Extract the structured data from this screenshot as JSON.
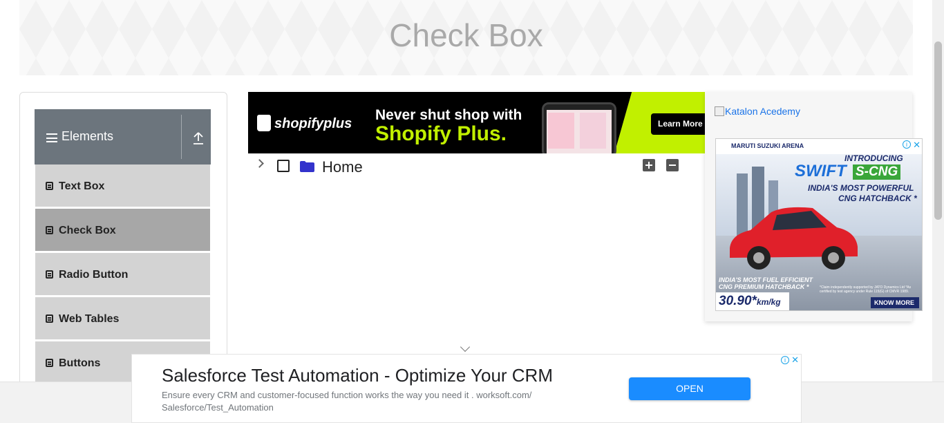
{
  "banner": {
    "title": "Check Box"
  },
  "sidebar": {
    "group_label": "Elements",
    "items": [
      {
        "label": "Text Box"
      },
      {
        "label": "Check Box",
        "active": true
      },
      {
        "label": "Radio Button"
      },
      {
        "label": "Web Tables"
      },
      {
        "label": "Buttons"
      }
    ]
  },
  "top_ad": {
    "brand": "shopifyplus",
    "headline_line1": "Never shut shop with",
    "headline_line2": "Shopify Plus.",
    "cta": "Learn More"
  },
  "tree": {
    "root_label": "Home",
    "checked": false,
    "expanded": false,
    "folder_color": "#3333cc",
    "expand_icon": "plus-icon",
    "collapse_icon": "minus-icon"
  },
  "right_ads": {
    "katalon_alt": "Katalon Acedemy",
    "car_ad": {
      "brand": "MARUTI SUZUKI ARENA",
      "introducing": "INTRODUCING",
      "model": "SWIFT",
      "variant": "S-CNG",
      "tagline1": "INDIA'S MOST POWERFUL",
      "tagline2": "CNG HATCHBACK *",
      "fuel1": "INDIA'S MOST FUEL EFFICIENT",
      "fuel2": "CNG PREMIUM HATCHBACK *",
      "mileage_value": "30.90*",
      "mileage_unit": "km/kg",
      "claim": "*Claim independently supported by JATO Dynamics Ltd *As certified by test agency under Rule 115(G) of CMVR 1989.",
      "cta": "KNOW MORE"
    }
  },
  "bottom_ad": {
    "title": "Salesforce Test Automation - Optimize Your CRM",
    "desc_line1": "Ensure every CRM and customer-focused function works the way you need it . worksoft.com/",
    "desc_line2": "Salesforce/Test_Automation",
    "cta": "OPEN"
  },
  "colors": {
    "sidebar_header": "#6c757d",
    "menu_item": "#d3d3d3",
    "menu_item_active": "#a7a7a7",
    "open_button": "#1a8cff",
    "lime": "#c1f000"
  }
}
